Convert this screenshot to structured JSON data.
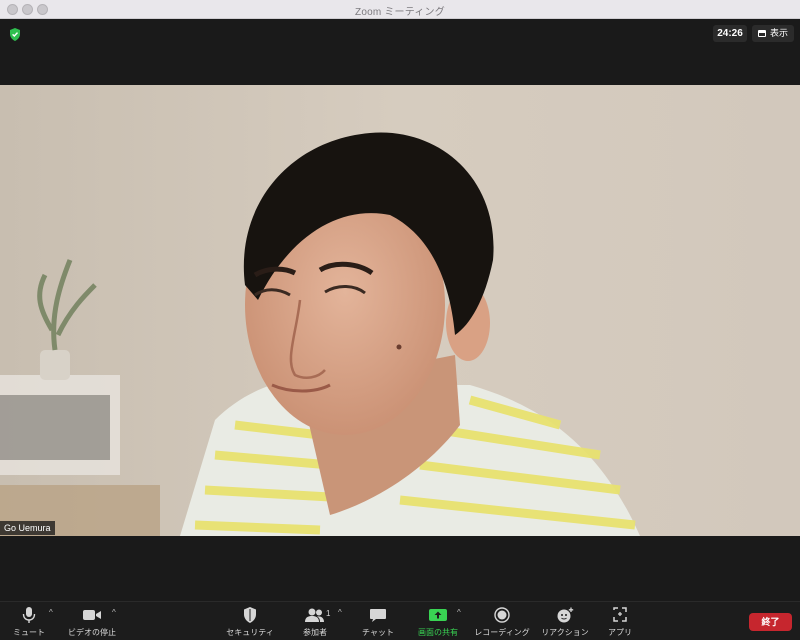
{
  "window": {
    "title": "Zoom ミーティング"
  },
  "meeting": {
    "timer": "24:26",
    "view_label": "表示",
    "participant_name": "Go Uemura",
    "participant_count": "1"
  },
  "toolbar": {
    "mute_label": "ミュート",
    "video_label": "ビデオの停止",
    "security_label": "セキュリティ",
    "participants_label": "参加者",
    "chat_label": "チャット",
    "share_label": "画面の共有",
    "record_label": "レコーディング",
    "reaction_label": "リアクション",
    "apps_label": "アプリ",
    "end_label": "終了"
  },
  "colors": {
    "share_green": "#39d353",
    "end_red": "#c6262e",
    "shield_green": "#2fbf4f"
  }
}
